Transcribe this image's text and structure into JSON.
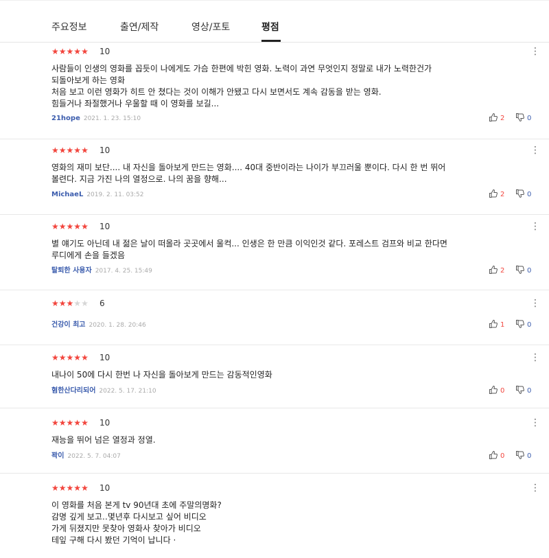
{
  "tabs": [
    {
      "label": "주요정보"
    },
    {
      "label": "출연/제작"
    },
    {
      "label": "영상/포토"
    },
    {
      "label": "평점"
    }
  ],
  "reviews": [
    {
      "score": "10",
      "stars": 5,
      "text": "사람들이 인생의 영화를 꼽듯이 나에게도 가슴 한편에 박힌 영화. 노력이 과연 무엇인지 정말로 내가 노력한건가\n되돌아보게 하는 영화\n처음 보고 이런 영화가 히트 안 쳤다는 것이 이해가 안됐고 다시 보면서도 계속 감동을 받는 영화.\n힘들거나 좌절했거나 우울할 때 이 영화를 보길...",
      "author": "21hope",
      "date": "2021. 1. 23. 15:10",
      "likes": "2",
      "dislikes": "0"
    },
    {
      "score": "10",
      "stars": 5,
      "text": "영화의 재미 보단.... 내 자신을 돌아보게 만드는 영화.... 40대 중반이라는 나이가 부끄러울 뿐이다. 다시 한 번 뛰어\n볼련다. 지금 가진 나의 열정으로. 나의 꿈을 향해...",
      "author": "MichaeL",
      "date": "2019. 2. 11. 03:52",
      "likes": "2",
      "dislikes": "0"
    },
    {
      "score": "10",
      "stars": 5,
      "text": "별 얘기도 아닌데 내 젊은 날이 떠올라 곳곳에서 울컥... 인생은 한 만큼 이익인것 같다. 포레스트 검프와 비교 한다면\n루디에게 손을 들겠음",
      "author": "탈퇴한 사용자",
      "date": "2017. 4. 25. 15:49",
      "likes": "2",
      "dislikes": "0"
    },
    {
      "score": "6",
      "stars": 3,
      "text": "",
      "author": "건강이 최고",
      "date": "2020. 1. 28. 20:46",
      "likes": "1",
      "dislikes": "0"
    },
    {
      "score": "10",
      "stars": 5,
      "text": "내나이 50에 다시 한번 나 자신을 돌아보게 만드는 감동적인영화",
      "author": "혐한산다리되어",
      "date": "2022. 5. 17. 21:10",
      "likes": "0",
      "dislikes": "0"
    },
    {
      "score": "10",
      "stars": 5,
      "text": "재능을 뛰어 넘은 열정과 정열.",
      "author": "꽉이",
      "date": "2022. 5. 7. 04:07",
      "likes": "0",
      "dislikes": "0"
    },
    {
      "score": "10",
      "stars": 5,
      "text": "이 영화를  처음 본게  tv  90년대  초에  주말의명화?\n감명  깊게  보고‥몇년후  다시보고  싶어  비디오\n가게  뒤졌지만  못찾아  영화사  찾아가  비디오\n테잎  구해  다시  봤던 기억이 납니다  ·",
      "author": "",
      "date": "",
      "likes": "",
      "dislikes": ""
    }
  ],
  "icons": {
    "more": "more-vertical-icon",
    "like": "thumbs-up-icon",
    "dislike": "thumbs-down-icon",
    "star": "star-icon"
  },
  "colors": {
    "star_active": "#f2453d",
    "star_inactive": "#d6d6d6",
    "author": "#3b5cad",
    "like": "#f2453d",
    "dislike": "#3b5cad"
  }
}
